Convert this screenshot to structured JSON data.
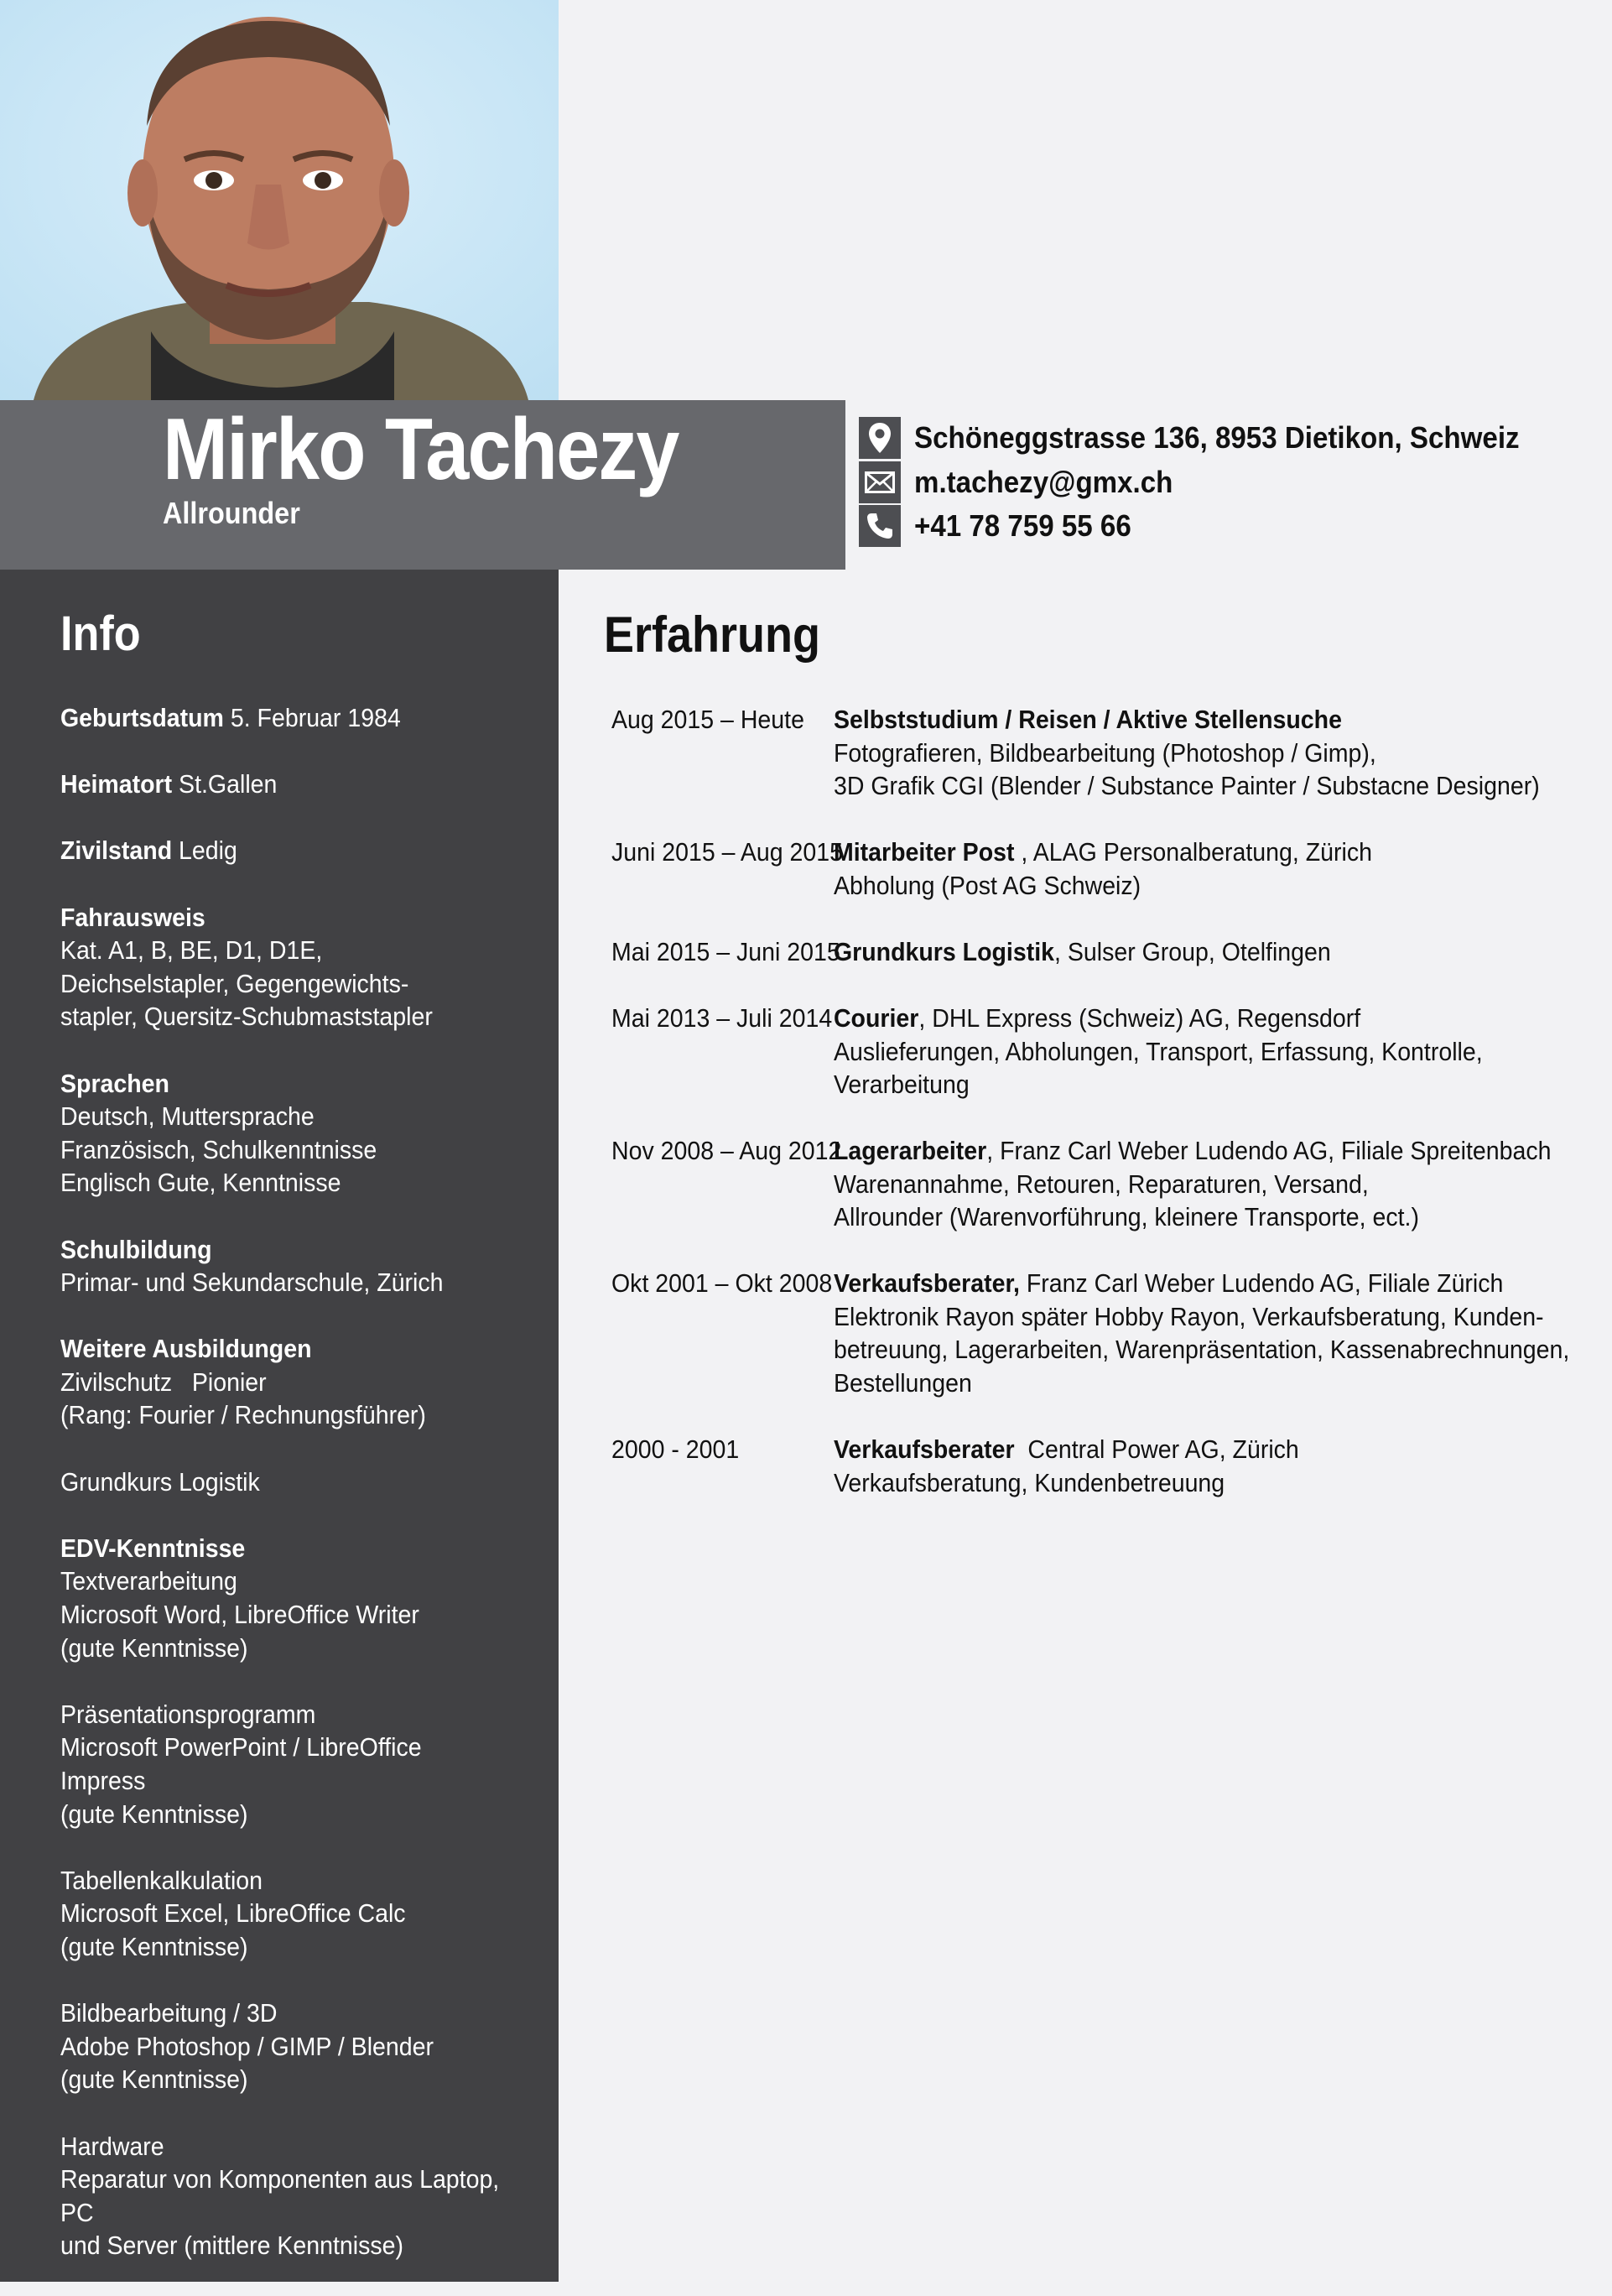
{
  "header": {
    "name": "Mirko Tachezy",
    "role": "Allrounder",
    "contact": {
      "address": "Schöneggstrasse 136, 8953 Dietikon, Schweiz",
      "email": "m.tachezy@gmx.ch",
      "phone": "+41 78 759 55 66"
    }
  },
  "sidebar": {
    "title": "Info",
    "birth_label": "Geburtsdatum",
    "birth_value": "5. Februar 1984",
    "origin_label": "Heimatort",
    "origin_value": "St.Gallen",
    "civil_label": "Zivilstand",
    "civil_value": "Ledig",
    "license_label": "Fahrausweis",
    "license_lines": [
      "Kat. A1, B, BE, D1, D1E,",
      "Deichselstapler, Gegengewichts-",
      "stapler, Quersitz-Schubmaststapler"
    ],
    "languages_label": "Sprachen",
    "languages_lines": [
      "Deutsch, Muttersprache",
      "Französisch, Schulkenntnisse",
      "Englisch Gute, Kenntnisse"
    ],
    "school_label": "Schulbildung",
    "school_lines": [
      "Primar- und Sekundarschule, Zürich"
    ],
    "training_label": "Weitere Ausbildungen",
    "training_lines": [
      "Zivilschutz   Pionier",
      "(Rang: Fourier / Rechnungsführer)"
    ],
    "training_extra": "Grundkurs Logistik",
    "it_label": "EDV-Kenntnisse",
    "it_groups": [
      [
        "Textverarbeitung",
        "Microsoft Word, LibreOffice Writer",
        "(gute Kenntnisse)"
      ],
      [
        "Präsentationsprogramm",
        "Microsoft PowerPoint / LibreOffice Impress",
        "(gute Kenntnisse)"
      ],
      [
        "Tabellenkalkulation",
        "Microsoft Excel, LibreOffice Calc",
        "(gute Kenntnisse)"
      ],
      [
        "Bildbearbeitung / 3D",
        "Adobe Photoshop / GIMP / Blender",
        "(gute Kenntnisse)"
      ],
      [
        "Hardware",
        "Reparatur von Komponenten aus Laptop, PC",
        "und Server (mittlere Kenntnisse)"
      ]
    ]
  },
  "experience": {
    "title": "Erfahrung",
    "entries": [
      {
        "date": "Aug 2015 – Heute",
        "title": "Selbststudium / Reisen / Aktive Stellensuche",
        "rest": "",
        "lines": [
          "Fotografieren, Bildbearbeitung (Photoshop / Gimp),",
          "3D Grafik CGI (Blender / Substance Painter / Substacne Designer)"
        ]
      },
      {
        "date": "Juni 2015 – Aug 2015",
        "title": "Mitarbeiter Post",
        "rest": " , ALAG Personalberatung, Zürich",
        "lines": [
          "Abholung (Post AG Schweiz)"
        ]
      },
      {
        "date": "Mai 2015 – Juni 2015",
        "title": "Grundkurs Logistik",
        "rest": ", Sulser Group, Otelfingen",
        "lines": []
      },
      {
        "date": "Mai 2013 – Juli 2014",
        "title": "Courier",
        "rest": ", DHL Express (Schweiz) AG, Regensdorf",
        "lines": [
          "Auslieferungen, Abholungen, Transport, Erfassung, Kontrolle,",
          "Verarbeitung"
        ]
      },
      {
        "date": "Nov 2008 – Aug 2012",
        "title": "Lagerarbeiter",
        "rest": ", Franz Carl Weber Ludendo AG, Filiale Spreitenbach",
        "lines": [
          "Warenannahme, Retouren, Reparaturen, Versand,",
          "Allrounder (Warenvorführung, kleinere Transporte, ect.)"
        ]
      },
      {
        "date": "Okt 2001 – Okt 2008",
        "title": "Verkaufsberater,",
        "rest": " Franz Carl Weber Ludendo AG, Filiale Zürich",
        "lines": [
          "Elektronik Rayon später Hobby Rayon, Verkaufsberatung, Kunden-",
          "betreuung, Lagerarbeiten, Warenpräsentation, Kassenabrechnungen,",
          "Bestellungen"
        ]
      },
      {
        "date": "2000 - 2001",
        "title": "Verkaufsberater",
        "rest": "  Central Power AG, Zürich",
        "lines": [
          "Verkaufsberatung, Kundenbetreuung"
        ]
      }
    ]
  }
}
